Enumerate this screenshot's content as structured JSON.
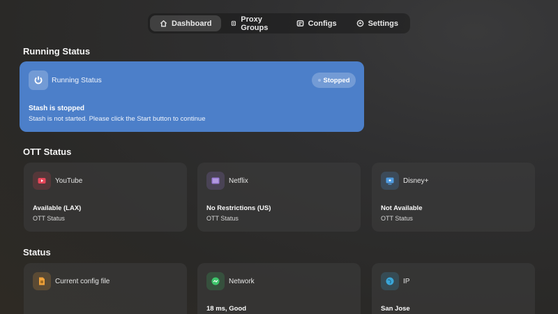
{
  "nav": {
    "items": [
      {
        "label": "Dashboard",
        "icon": "home-icon",
        "active": true
      },
      {
        "label": "Proxy Groups",
        "icon": "list-icon",
        "active": false
      },
      {
        "label": "Configs",
        "icon": "config-icon",
        "active": false
      },
      {
        "label": "Settings",
        "icon": "settings-icon",
        "active": false
      }
    ]
  },
  "running_section": {
    "title": "Running Status",
    "card": {
      "label": "Running Status",
      "icon": "power-icon",
      "status": "Stopped",
      "headline": "Stash is stopped",
      "description": "Stash is not started. Please click the Start button to continue",
      "color": "#4c7fc9"
    }
  },
  "ott_section": {
    "title": "OTT Status",
    "cards": [
      {
        "label": "YouTube",
        "icon": "youtube-icon",
        "value": "Available (LAX)",
        "sub": "OTT Status",
        "accent": "#e8475a"
      },
      {
        "label": "Netflix",
        "icon": "netflix-icon",
        "value": "No Restrictions (US)",
        "sub": "OTT Status",
        "accent": "#9a7bd6"
      },
      {
        "label": "Disney+",
        "icon": "disney-icon",
        "value": "Not Available",
        "sub": "OTT Status",
        "accent": "#4f9be0"
      }
    ]
  },
  "status_section": {
    "title": "Status",
    "cards": [
      {
        "label": "Current config file",
        "icon": "file-icon",
        "value": "",
        "accent": "#f0a23a"
      },
      {
        "label": "Network",
        "icon": "network-icon",
        "value": "18 ms, Good",
        "accent": "#3dc46b"
      },
      {
        "label": "IP",
        "icon": "globe-icon",
        "value": "San Jose",
        "accent": "#3aa6d8"
      }
    ]
  }
}
